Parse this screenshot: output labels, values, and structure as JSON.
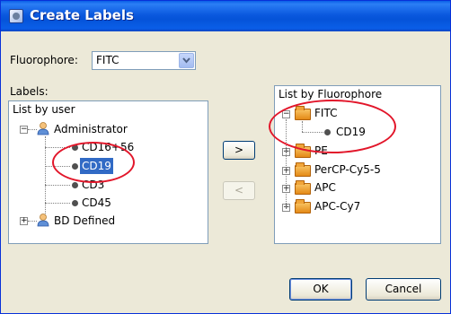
{
  "window": {
    "title": "Create Labels"
  },
  "fluorophore": {
    "label": "Fluorophore:",
    "value": "FITC"
  },
  "labels_heading": "Labels:",
  "left_tree": {
    "root": "List by user",
    "groups": [
      {
        "name": "Administrator",
        "expanded": true,
        "items": [
          "CD16+56",
          "CD19",
          "CD3",
          "CD45"
        ],
        "selected": "CD19"
      },
      {
        "name": "BD Defined",
        "expanded": false,
        "items": []
      }
    ]
  },
  "right_tree": {
    "root": "List by Fluorophore",
    "groups": [
      {
        "name": "FITC",
        "expanded": true,
        "items": [
          "CD19"
        ]
      },
      {
        "name": "PE",
        "expanded": false
      },
      {
        "name": "PerCP-Cy5-5",
        "expanded": false
      },
      {
        "name": "APC",
        "expanded": false
      },
      {
        "name": "APC-Cy7",
        "expanded": false
      }
    ]
  },
  "buttons": {
    "add": ">",
    "remove": "<",
    "ok": "OK",
    "cancel": "Cancel"
  },
  "annotation_color": "#e2162a"
}
